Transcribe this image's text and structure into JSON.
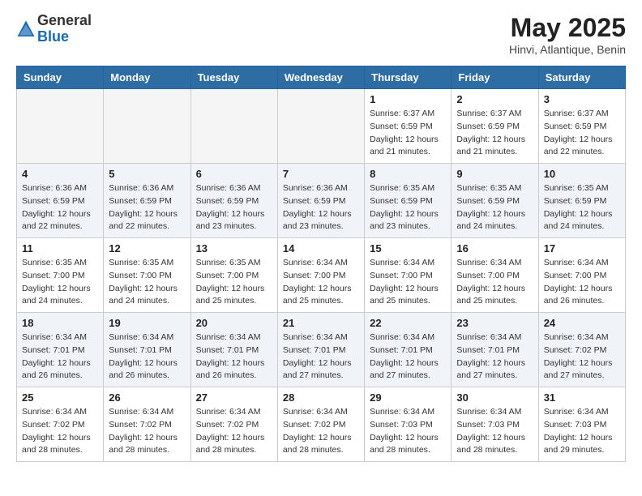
{
  "header": {
    "logo_general": "General",
    "logo_blue": "Blue",
    "title": "May 2025",
    "location": "Hinvi, Atlantique, Benin"
  },
  "days_of_week": [
    "Sunday",
    "Monday",
    "Tuesday",
    "Wednesday",
    "Thursday",
    "Friday",
    "Saturday"
  ],
  "weeks": [
    [
      {
        "day": "",
        "info": ""
      },
      {
        "day": "",
        "info": ""
      },
      {
        "day": "",
        "info": ""
      },
      {
        "day": "",
        "info": ""
      },
      {
        "day": "1",
        "info": "Sunrise: 6:37 AM\nSunset: 6:59 PM\nDaylight: 12 hours\nand 21 minutes."
      },
      {
        "day": "2",
        "info": "Sunrise: 6:37 AM\nSunset: 6:59 PM\nDaylight: 12 hours\nand 21 minutes."
      },
      {
        "day": "3",
        "info": "Sunrise: 6:37 AM\nSunset: 6:59 PM\nDaylight: 12 hours\nand 22 minutes."
      }
    ],
    [
      {
        "day": "4",
        "info": "Sunrise: 6:36 AM\nSunset: 6:59 PM\nDaylight: 12 hours\nand 22 minutes."
      },
      {
        "day": "5",
        "info": "Sunrise: 6:36 AM\nSunset: 6:59 PM\nDaylight: 12 hours\nand 22 minutes."
      },
      {
        "day": "6",
        "info": "Sunrise: 6:36 AM\nSunset: 6:59 PM\nDaylight: 12 hours\nand 23 minutes."
      },
      {
        "day": "7",
        "info": "Sunrise: 6:36 AM\nSunset: 6:59 PM\nDaylight: 12 hours\nand 23 minutes."
      },
      {
        "day": "8",
        "info": "Sunrise: 6:35 AM\nSunset: 6:59 PM\nDaylight: 12 hours\nand 23 minutes."
      },
      {
        "day": "9",
        "info": "Sunrise: 6:35 AM\nSunset: 6:59 PM\nDaylight: 12 hours\nand 24 minutes."
      },
      {
        "day": "10",
        "info": "Sunrise: 6:35 AM\nSunset: 6:59 PM\nDaylight: 12 hours\nand 24 minutes."
      }
    ],
    [
      {
        "day": "11",
        "info": "Sunrise: 6:35 AM\nSunset: 7:00 PM\nDaylight: 12 hours\nand 24 minutes."
      },
      {
        "day": "12",
        "info": "Sunrise: 6:35 AM\nSunset: 7:00 PM\nDaylight: 12 hours\nand 24 minutes."
      },
      {
        "day": "13",
        "info": "Sunrise: 6:35 AM\nSunset: 7:00 PM\nDaylight: 12 hours\nand 25 minutes."
      },
      {
        "day": "14",
        "info": "Sunrise: 6:34 AM\nSunset: 7:00 PM\nDaylight: 12 hours\nand 25 minutes."
      },
      {
        "day": "15",
        "info": "Sunrise: 6:34 AM\nSunset: 7:00 PM\nDaylight: 12 hours\nand 25 minutes."
      },
      {
        "day": "16",
        "info": "Sunrise: 6:34 AM\nSunset: 7:00 PM\nDaylight: 12 hours\nand 25 minutes."
      },
      {
        "day": "17",
        "info": "Sunrise: 6:34 AM\nSunset: 7:00 PM\nDaylight: 12 hours\nand 26 minutes."
      }
    ],
    [
      {
        "day": "18",
        "info": "Sunrise: 6:34 AM\nSunset: 7:01 PM\nDaylight: 12 hours\nand 26 minutes."
      },
      {
        "day": "19",
        "info": "Sunrise: 6:34 AM\nSunset: 7:01 PM\nDaylight: 12 hours\nand 26 minutes."
      },
      {
        "day": "20",
        "info": "Sunrise: 6:34 AM\nSunset: 7:01 PM\nDaylight: 12 hours\nand 26 minutes."
      },
      {
        "day": "21",
        "info": "Sunrise: 6:34 AM\nSunset: 7:01 PM\nDaylight: 12 hours\nand 27 minutes."
      },
      {
        "day": "22",
        "info": "Sunrise: 6:34 AM\nSunset: 7:01 PM\nDaylight: 12 hours\nand 27 minutes."
      },
      {
        "day": "23",
        "info": "Sunrise: 6:34 AM\nSunset: 7:01 PM\nDaylight: 12 hours\nand 27 minutes."
      },
      {
        "day": "24",
        "info": "Sunrise: 6:34 AM\nSunset: 7:02 PM\nDaylight: 12 hours\nand 27 minutes."
      }
    ],
    [
      {
        "day": "25",
        "info": "Sunrise: 6:34 AM\nSunset: 7:02 PM\nDaylight: 12 hours\nand 28 minutes."
      },
      {
        "day": "26",
        "info": "Sunrise: 6:34 AM\nSunset: 7:02 PM\nDaylight: 12 hours\nand 28 minutes."
      },
      {
        "day": "27",
        "info": "Sunrise: 6:34 AM\nSunset: 7:02 PM\nDaylight: 12 hours\nand 28 minutes."
      },
      {
        "day": "28",
        "info": "Sunrise: 6:34 AM\nSunset: 7:02 PM\nDaylight: 12 hours\nand 28 minutes."
      },
      {
        "day": "29",
        "info": "Sunrise: 6:34 AM\nSunset: 7:03 PM\nDaylight: 12 hours\nand 28 minutes."
      },
      {
        "day": "30",
        "info": "Sunrise: 6:34 AM\nSunset: 7:03 PM\nDaylight: 12 hours\nand 28 minutes."
      },
      {
        "day": "31",
        "info": "Sunrise: 6:34 AM\nSunset: 7:03 PM\nDaylight: 12 hours\nand 29 minutes."
      }
    ]
  ]
}
